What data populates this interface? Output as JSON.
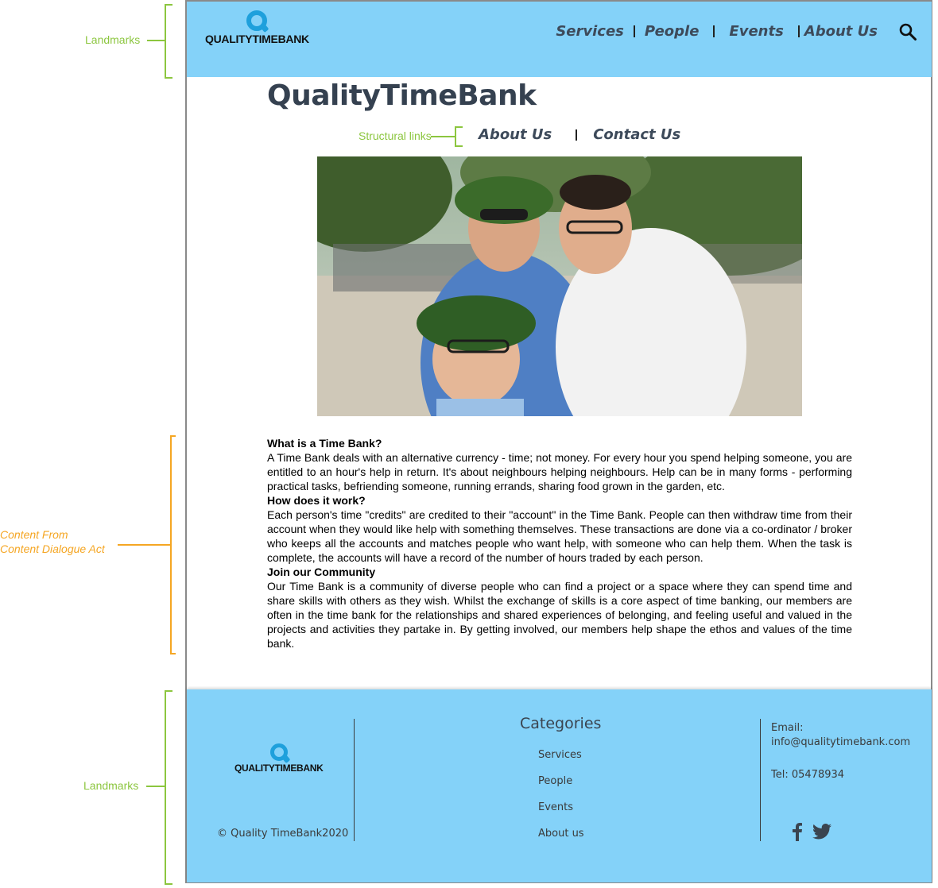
{
  "annotations": {
    "landmarks_top": "Landmarks",
    "structural_links": "Structural links",
    "content_line1": "Content From",
    "content_line2": "Content Dialogue Act",
    "landmarks_bottom": "Landmarks"
  },
  "header": {
    "logo_text": "QUALITYTIMEBANK",
    "nav": [
      "Services",
      "People",
      "Events",
      "About Us"
    ],
    "search_icon": "search-icon"
  },
  "main": {
    "title": "QualityTimeBank",
    "structural_links": [
      "About Us",
      "Contact Us"
    ],
    "sections": [
      {
        "heading": "What is a Time Bank?",
        "body": "A Time Bank deals with an alternative currency - time; not money. For every hour you spend helping someone, you are entitled to an hour's help in return. It's about neighbours helping neighbours. Help can be in many forms - performing practical tasks, befriending someone, running errands, sharing food grown in the garden, etc."
      },
      {
        "heading": "How does it work?",
        "body": "Each person's time \"credits\" are credited to their \"account\" in the Time Bank. People can then withdraw time from their account when they would like help with something themselves. These transactions are done via a co-ordinator / broker who keeps all the accounts and matches people who want help, with someone who can help them. When the task is complete, the accounts will have a record of the number of hours traded by each person."
      },
      {
        "heading": "Join our Community",
        "body": "Our Time Bank is a community of diverse people who can find a project or a space where they can spend time and share skills with others as they wish. Whilst the exchange of skills is a core aspect of time banking,  our members are often in the time bank for the relationships and shared experiences of belonging,  and feeling useful and valued in the projects and activities they partake in. By getting involved, our members help shape the ethos and values of the time bank."
      }
    ]
  },
  "footer": {
    "logo_text": "QUALITYTIMEBANK",
    "copyright": "© Quality TimeBank2020",
    "categories_heading": "Categories",
    "categories": [
      "Services",
      "People",
      "Events",
      "About us"
    ],
    "email_label": "Email:",
    "email": "info@qualitytimebank.com",
    "tel": "Tel: 05478934",
    "social_icons": [
      "facebook-icon",
      "twitter-icon"
    ]
  },
  "colors": {
    "header_bg": "#84d2f9",
    "annotation_green": "#8cc63f",
    "annotation_orange": "#f5a623",
    "title_color": "#354150"
  }
}
